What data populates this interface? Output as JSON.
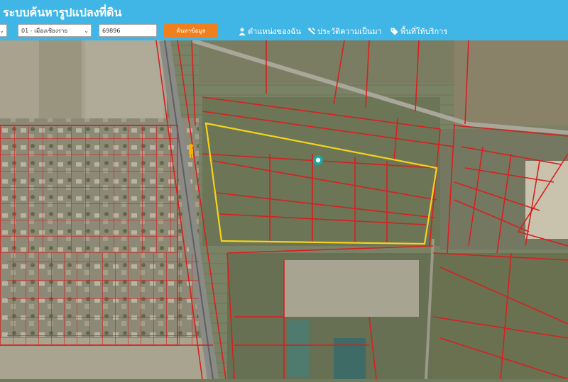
{
  "header": {
    "title": "ระบบค้นหารูปแปลงที่ดิน",
    "province_value": "",
    "district_value": "01 - เมืองเชียงราย",
    "parcel_value": "69896",
    "search_label": "ค้นหาข้อมูล",
    "nav": [
      {
        "label": "ตำแหน่งของฉัน",
        "icon": "person-icon"
      },
      {
        "label": "ประวัติความเป็นมา",
        "icon": "history-icon"
      },
      {
        "label": "พื้นที่ให้บริการ",
        "icon": "tag-icon"
      }
    ]
  },
  "map": {
    "highlight_color": "#f5d31c",
    "parcel_line_color": "#d62020",
    "marker": "location-marker-icon",
    "pegman": "street-view-pegman-icon"
  }
}
